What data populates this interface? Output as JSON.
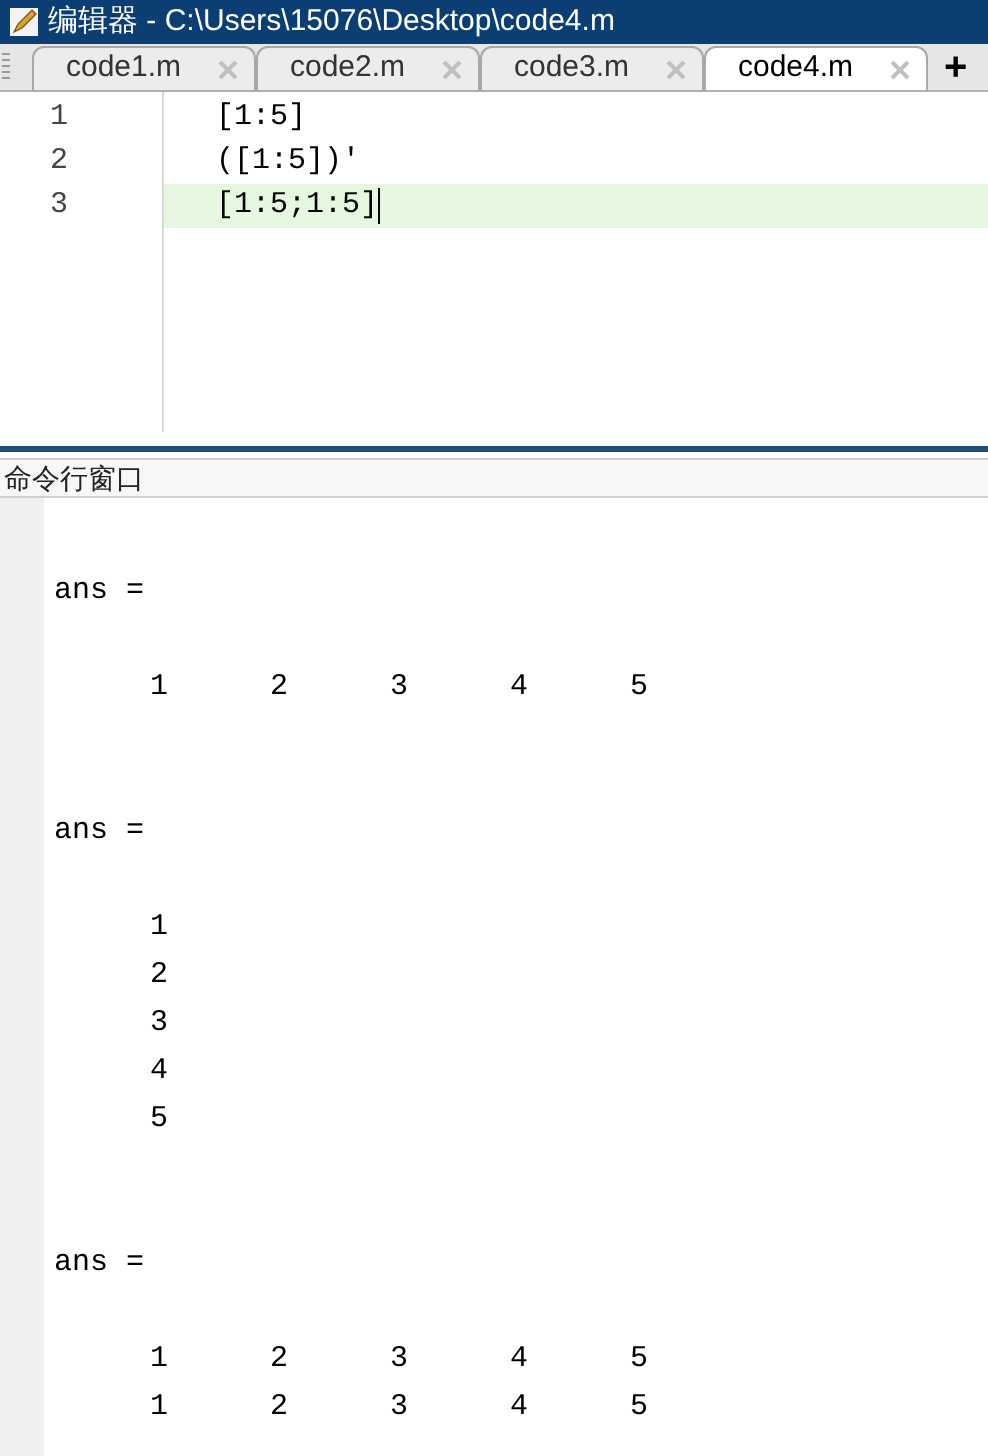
{
  "window": {
    "title": "编辑器 - C:\\Users\\15076\\Desktop\\code4.m"
  },
  "tabs": [
    {
      "label": "code1.m",
      "selected": false
    },
    {
      "label": "code2.m",
      "selected": false
    },
    {
      "label": "code3.m",
      "selected": false
    },
    {
      "label": "code4.m",
      "selected": true
    }
  ],
  "new_tab": "+",
  "editor": {
    "lines": [
      {
        "number": "1",
        "code": "[1:5]",
        "current": false
      },
      {
        "number": "2",
        "code": "([1:5])'",
        "current": false
      },
      {
        "number": "3",
        "code": "[1:5;1:5]",
        "current": true
      }
    ]
  },
  "command_window": {
    "title": "命令行窗口",
    "lines": [
      {
        "kind": "blank"
      },
      {
        "kind": "text",
        "text": "ans ="
      },
      {
        "kind": "blank"
      },
      {
        "kind": "row",
        "cells": [
          "1",
          "2",
          "3",
          "4",
          "5"
        ]
      },
      {
        "kind": "blank"
      },
      {
        "kind": "blank"
      },
      {
        "kind": "text",
        "text": "ans ="
      },
      {
        "kind": "blank"
      },
      {
        "kind": "row",
        "cells": [
          "1"
        ]
      },
      {
        "kind": "row",
        "cells": [
          "2"
        ]
      },
      {
        "kind": "row",
        "cells": [
          "3"
        ]
      },
      {
        "kind": "row",
        "cells": [
          "4"
        ]
      },
      {
        "kind": "row",
        "cells": [
          "5"
        ]
      },
      {
        "kind": "blank"
      },
      {
        "kind": "blank"
      },
      {
        "kind": "text",
        "text": "ans ="
      },
      {
        "kind": "blank"
      },
      {
        "kind": "row",
        "cells": [
          "1",
          "2",
          "3",
          "4",
          "5"
        ]
      },
      {
        "kind": "row",
        "cells": [
          "1",
          "2",
          "3",
          "4",
          "5"
        ]
      }
    ]
  }
}
